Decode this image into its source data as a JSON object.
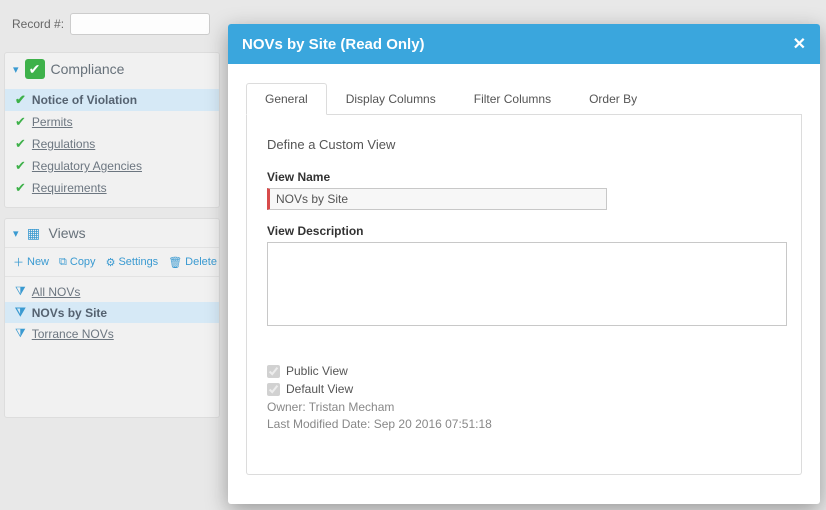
{
  "topbar": {
    "record_label": "Record #:"
  },
  "compliance": {
    "title": "Compliance",
    "items": [
      {
        "label": "Notice of Violation",
        "active": true
      },
      {
        "label": "Permits",
        "active": false
      },
      {
        "label": "Regulations",
        "active": false
      },
      {
        "label": "Regulatory Agencies",
        "active": false
      },
      {
        "label": "Requirements",
        "active": false
      }
    ]
  },
  "views_panel": {
    "title": "Views",
    "toolbar": {
      "new": "New",
      "copy": "Copy",
      "settings": "Settings",
      "delete": "Delete"
    },
    "items": [
      {
        "label": "All NOVs",
        "active": false
      },
      {
        "label": "NOVs by Site",
        "active": true
      },
      {
        "label": "Torrance NOVs",
        "active": false
      }
    ]
  },
  "modal": {
    "title": "NOVs by Site (Read Only)",
    "tabs": [
      {
        "label": "General",
        "active": true
      },
      {
        "label": "Display Columns",
        "active": false
      },
      {
        "label": "Filter Columns",
        "active": false
      },
      {
        "label": "Order By",
        "active": false
      }
    ],
    "section_title": "Define a Custom View",
    "view_name_label": "View Name",
    "view_name_value": "NOVs by Site",
    "view_desc_label": "View Description",
    "view_desc_value": "",
    "public_view_label": "Public View",
    "public_view_checked": true,
    "default_view_label": "Default View",
    "default_view_checked": true,
    "owner_line": "Owner: Tristan Mecham",
    "modified_line": "Last Modified Date: Sep 20 2016 07:51:18"
  }
}
